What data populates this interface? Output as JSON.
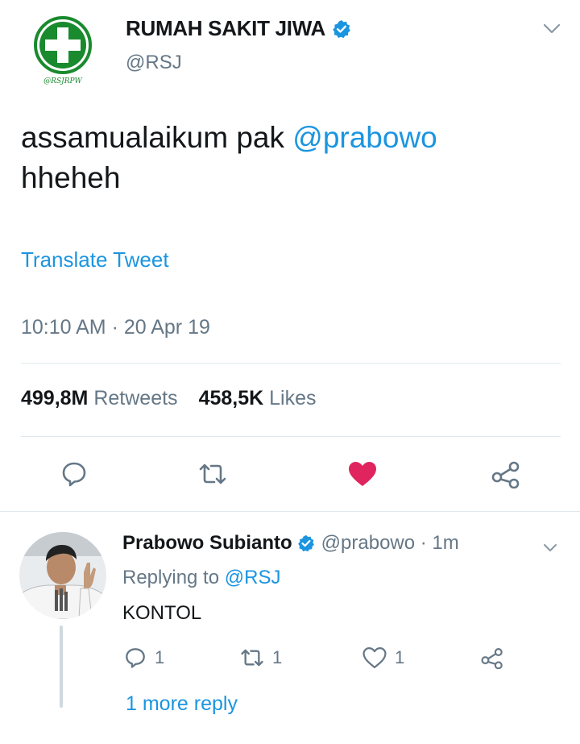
{
  "main_tweet": {
    "author_name": "RUMAH SAKIT JIWA",
    "author_handle": "@RSJ",
    "avatar_caption": "@RSJRPW",
    "text_before": "assamualaikum pak ",
    "mention": "@prabowo",
    "text_after": "hheheh",
    "translate_label": "Translate Tweet",
    "timestamp": "10:10 AM · 20 Apr 19",
    "retweets_count": "499,8M",
    "retweets_label": "Retweets",
    "likes_count": "458,5K",
    "likes_label": "Likes",
    "liked": true
  },
  "reply": {
    "author_name": "Prabowo Subianto",
    "author_handle": "@prabowo",
    "time": "1m",
    "meta": "@prabowo · 1m",
    "replying_label": "Replying to ",
    "replying_to": "@RSJ",
    "text": "KONTOL",
    "reply_count": "1",
    "retweet_count": "1",
    "like_count": "1",
    "more_replies": "1 more reply"
  },
  "colors": {
    "accent": "#1b95e0",
    "muted": "#657786",
    "like": "#e0245e",
    "divider": "#e1e8ed",
    "logo_green": "#1a8a2e"
  },
  "icons": [
    "verified-icon",
    "chevron-down-icon",
    "reply-icon",
    "retweet-icon",
    "heart-filled-icon",
    "share-icon",
    "heart-outline-icon"
  ]
}
